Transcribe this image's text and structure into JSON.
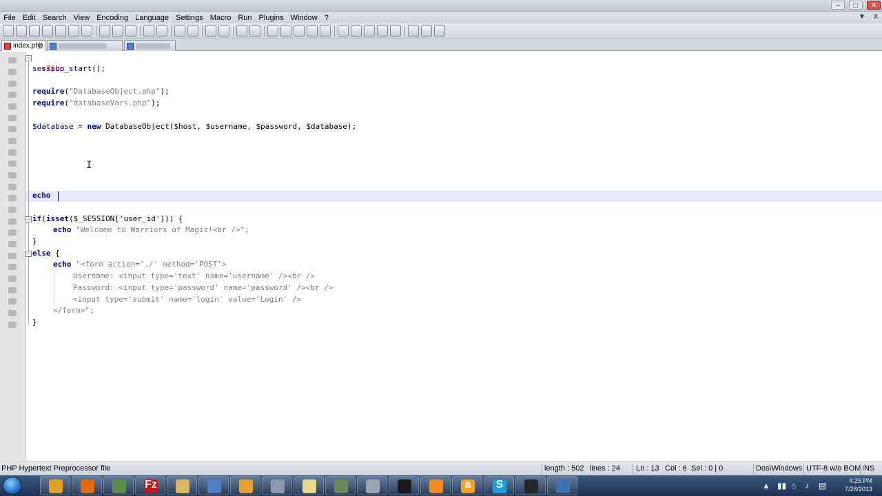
{
  "window": {
    "title": "",
    "controls": [
      "–",
      "□",
      "✕"
    ]
  },
  "menu": [
    "File",
    "Edit",
    "Search",
    "View",
    "Encoding",
    "Language",
    "Settings",
    "Macro",
    "Run",
    "Plugins",
    "Window",
    "?"
  ],
  "menu_right": [
    "▼",
    "X"
  ],
  "tabs": [
    {
      "label": "index.php",
      "close": "✕",
      "active": true
    },
    {
      "label": "",
      "active": false
    },
    {
      "label": "",
      "active": false
    }
  ],
  "code": {
    "l1_open": "<?php",
    "l2_fn": "session_start",
    "l2_rest": "();",
    "l4_kw": "require",
    "l4_open": "(",
    "l4_str": "\"DatabaseObject.php\"",
    "l4_close": ");",
    "l5_kw": "require",
    "l5_open": "(",
    "l5_str": "\"databaseVars.php\"",
    "l5_close": ");",
    "l7_var": "$database",
    "l7_eq": " = ",
    "l7_kw": "new",
    "l7_rest": " DatabaseObject($host, $username, $password, $database);",
    "l13_kw": "echo",
    "l15_kw": "if",
    "l15_paren": "(",
    "l15_fn": "isset",
    "l15_rest": "($_SESSION['user_id'])) {",
    "l16_kw": "echo",
    "l16_str": " \"Welcome to Warriors of Magic!<br />\";",
    "l17": "}",
    "l18_kw": "else",
    "l18_rest": " {",
    "l19_kw": "echo",
    "l19_str": " \"<form action='./' method='POST'>",
    "l20": "Username: <input type='text' name='username' /><br />",
    "l21": "Password: <input type='password' name='password' /><br />",
    "l22": "<input type='submit' name='login' value='Login' />",
    "l23": "</form>\";",
    "l24": "}"
  },
  "status": {
    "file_type": "PHP Hypertext Preprocessor file",
    "length": "length : 502",
    "lines": "lines : 24",
    "ln": "Ln : 13",
    "col": "Col : 6",
    "sel": "Sel : 0 | 0",
    "eol": "Dos\\Windows",
    "encoding": "UTF-8 w/o BOM",
    "mode": "INS"
  },
  "taskbar": {
    "apps": [
      {
        "name": "chrome",
        "color": "#e0a020"
      },
      {
        "name": "firefox",
        "color": "#e06a10"
      },
      {
        "name": "photos",
        "color": "#5e8c4a"
      },
      {
        "name": "filezilla",
        "color": "#c01818",
        "glyph": "Fz"
      },
      {
        "name": "explorer",
        "color": "#d9b760"
      },
      {
        "name": "network",
        "color": "#4d7fc4"
      },
      {
        "name": "outlook",
        "color": "#e8a030"
      },
      {
        "name": "tool",
        "color": "#8a9ab0"
      },
      {
        "name": "notes",
        "color": "#e8d890"
      },
      {
        "name": "gimp",
        "color": "#6a8a5a"
      },
      {
        "name": "media",
        "color": "#9aa6b4"
      },
      {
        "name": "console",
        "color": "#1a1a1a"
      },
      {
        "name": "vlc",
        "color": "#f08a20"
      },
      {
        "name": "amazon",
        "color": "#f0a030",
        "glyph": "a"
      },
      {
        "name": "skype",
        "color": "#1aa0e0",
        "glyph": "S"
      },
      {
        "name": "steam",
        "color": "#202830"
      },
      {
        "name": "app",
        "color": "#4070b0"
      }
    ],
    "tray": [
      "▲",
      "▮▮",
      "⌂",
      "♪",
      "▤"
    ],
    "time": "4:25 PM",
    "date": "7/28/2013"
  }
}
